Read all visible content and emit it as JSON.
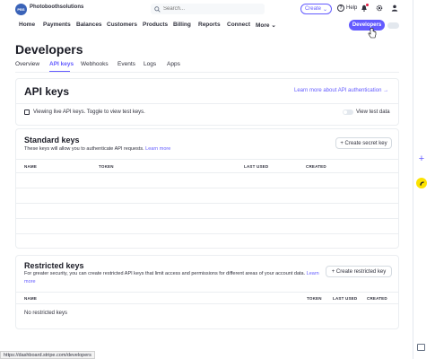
{
  "header": {
    "account_name": "Photoboothsolutions",
    "logo_text": "PBS",
    "search_placeholder": "Search...",
    "create_label": "Create",
    "help_label": "Help"
  },
  "nav": {
    "items": [
      "Home",
      "Payments",
      "Balances",
      "Customers",
      "Products",
      "Billing",
      "Reports",
      "Connect",
      "More"
    ],
    "developers_label": "Developers"
  },
  "page": {
    "title": "Developers",
    "tabs": [
      "Overview",
      "API keys",
      "Webhooks",
      "Events",
      "Logs",
      "Apps"
    ],
    "active_tab": "API keys"
  },
  "api_keys": {
    "title": "API keys",
    "learn_more": "Learn more about API authentication →",
    "live_notice": "Viewing live API keys. Toggle to view test keys.",
    "view_test_data": "View test data"
  },
  "standard_keys": {
    "title": "Standard keys",
    "description": "These keys will allow you to authenticate API requests.",
    "learn_more": "Learn more",
    "create_button": "+ Create secret key",
    "columns": [
      "NAME",
      "TOKEN",
      "LAST USED",
      "CREATED"
    ]
  },
  "restricted_keys": {
    "title": "Restricted keys",
    "description": "For greater security, you can create restricted API keys that limit access and permissions for different areas of your account data.",
    "learn_more": "Learn more",
    "create_button": "+ Create restricted key",
    "columns": [
      "NAME",
      "TOKEN",
      "LAST USED",
      "CREATED"
    ],
    "empty_text": "No restricted keys"
  },
  "status_url": "https://dashboard.stripe.com/developers",
  "colors": {
    "accent": "#635bff",
    "text": "#30313d"
  }
}
